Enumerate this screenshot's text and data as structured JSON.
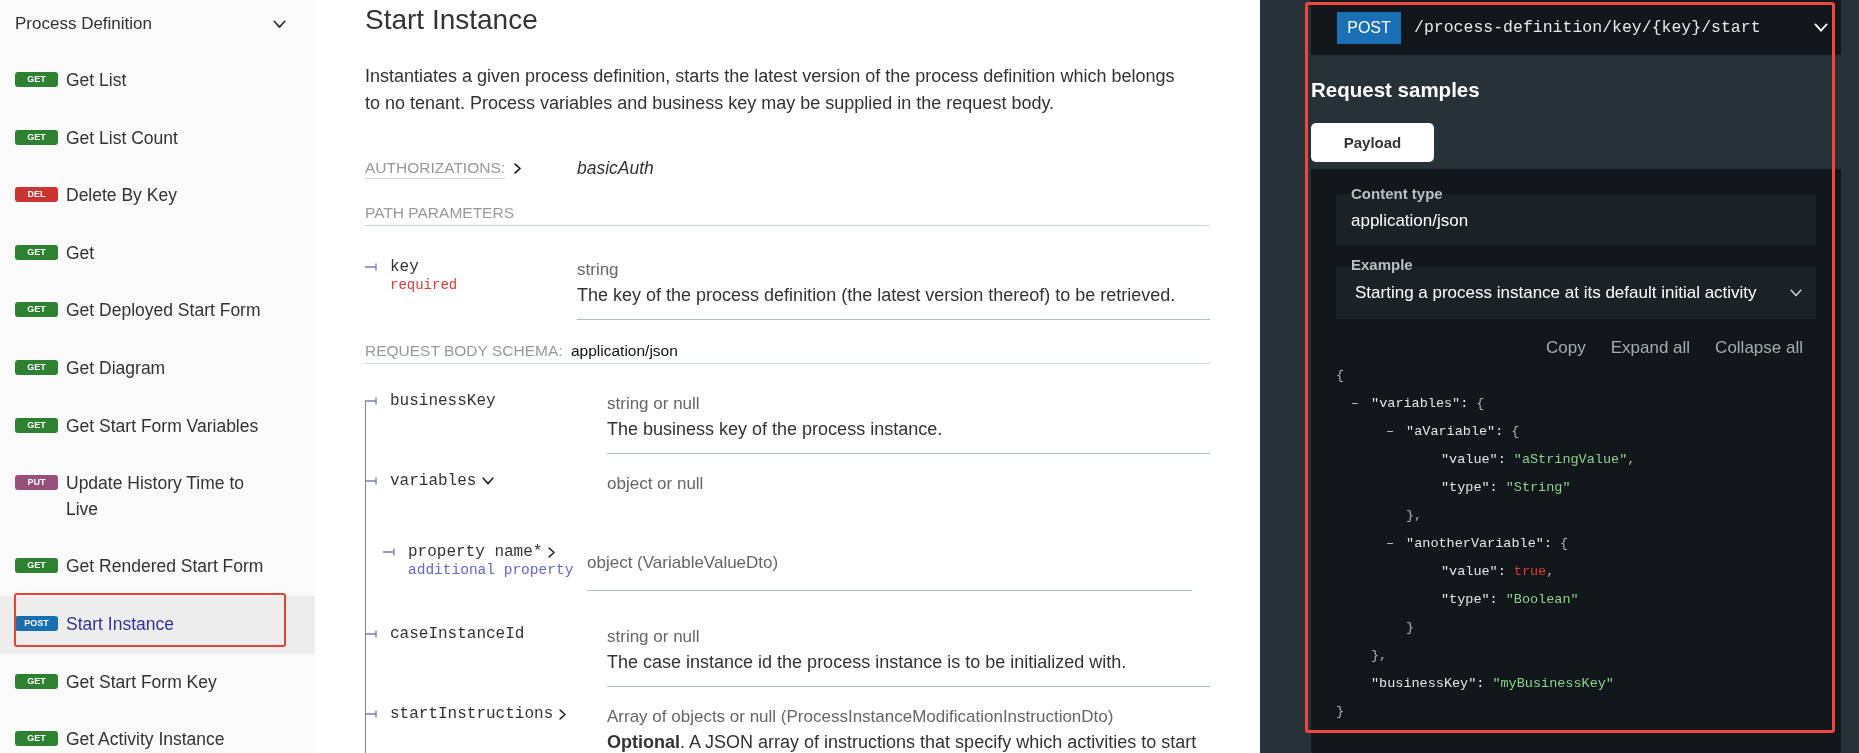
{
  "sidebar": {
    "group": {
      "title": "Process Definition",
      "expanded": true
    },
    "items": [
      {
        "method": "GET",
        "color": "#2f8132",
        "label": "Get List",
        "selected": false,
        "highlighted": false
      },
      {
        "method": "GET",
        "color": "#2f8132",
        "label": "Get List Count",
        "selected": false,
        "highlighted": false
      },
      {
        "method": "DEL",
        "color": "#cc3333",
        "label": "Delete By Key",
        "selected": false,
        "highlighted": false
      },
      {
        "method": "GET",
        "color": "#2f8132",
        "label": "Get",
        "selected": false,
        "highlighted": false
      },
      {
        "method": "GET",
        "color": "#2f8132",
        "label": "Get Deployed Start Form",
        "selected": false,
        "highlighted": false
      },
      {
        "method": "GET",
        "color": "#2f8132",
        "label": "Get Diagram",
        "selected": false,
        "highlighted": false
      },
      {
        "method": "GET",
        "color": "#2f8132",
        "label": "Get Start Form Variables",
        "selected": false,
        "highlighted": false
      },
      {
        "method": "PUT",
        "color": "#95507c",
        "label": "Update History Time to Live",
        "selected": false,
        "highlighted": false
      },
      {
        "method": "GET",
        "color": "#2f8132",
        "label": "Get Rendered Start Form",
        "selected": false,
        "highlighted": false
      },
      {
        "method": "POST",
        "color": "#186faf",
        "label": "Start Instance",
        "selected": true,
        "highlighted": true
      },
      {
        "method": "GET",
        "color": "#2f8132",
        "label": "Get Start Form Key",
        "selected": false,
        "highlighted": false
      },
      {
        "method": "GET",
        "color": "#2f8132",
        "label": "Get Activity Instance",
        "selected": false,
        "highlighted": false
      }
    ]
  },
  "operation": {
    "title": "Start Instance",
    "description": "Instantiates a given process definition, starts the latest version of the process definition which belongs to no tenant. Process variables and business key may be supplied in the request body.",
    "authorizations": {
      "label": "AUTHORIZATIONS:",
      "value": "basicAuth"
    },
    "path_parameters": {
      "heading": "PATH PARAMETERS",
      "params": [
        {
          "name": "key",
          "required": "required",
          "type": "string",
          "description": "The key of the process definition (the latest version thereof) to be retrieved."
        }
      ]
    },
    "request_body": {
      "label": "REQUEST BODY SCHEMA:",
      "content_type": "application/json",
      "fields": [
        {
          "name": "businessKey",
          "type": "string or null",
          "description": "The business key of the process instance."
        },
        {
          "name": "variables",
          "type": "object or null",
          "expanded": true,
          "children": [
            {
              "name": "property name*",
              "note": "additional property",
              "type": "object (VariableValueDto)",
              "expanded": false
            }
          ]
        },
        {
          "name": "caseInstanceId",
          "type": "string or null",
          "description": "The case instance id the process instance is to be initialized with."
        },
        {
          "name": "startInstructions",
          "type": "Array of objects or null (ProcessInstanceModificationInstructionDto)",
          "expanded": false,
          "description": "**Optional**. A JSON array of instructions that specify which activities to start"
        }
      ]
    }
  },
  "request_panel": {
    "highlighted": true,
    "endpoint": {
      "method": "POST",
      "path": "/process-definition/key/{key}/start",
      "expanded": true
    },
    "title": "Request samples",
    "tabs": [
      {
        "label": "Payload",
        "selected": true
      }
    ],
    "content_type": {
      "label": "Content type",
      "value": "application/json"
    },
    "example": {
      "label": "Example",
      "value": "Starting a process instance at its default initial activity"
    },
    "actions": [
      "Copy",
      "Expand all",
      "Collapse all"
    ],
    "code": {
      "open": "{",
      "close": "}",
      "children": [
        {
          "toggle": "–",
          "key": "\"variables\":",
          "open": "{",
          "close": "},",
          "children": [
            {
              "toggle": "–",
              "key": "\"aVariable\":",
              "open": "{",
              "close": "},",
              "children": [
                {
                  "key": "\"value\":",
                  "value": "\"aStringValue\"",
                  "kind": "string",
                  "tail": ","
                },
                {
                  "key": "\"type\":",
                  "value": "\"String\"",
                  "kind": "string"
                }
              ]
            },
            {
              "toggle": "–",
              "key": "\"anotherVariable\":",
              "open": "{",
              "close": "}",
              "children": [
                {
                  "key": "\"value\":",
                  "value": "true",
                  "kind": "boolean",
                  "tail": ","
                },
                {
                  "key": "\"type\":",
                  "value": "\"Boolean\"",
                  "kind": "string"
                }
              ]
            }
          ]
        },
        {
          "key": "\"businessKey\":",
          "value": "\"myBusinessKey\"",
          "kind": "string"
        }
      ]
    }
  }
}
